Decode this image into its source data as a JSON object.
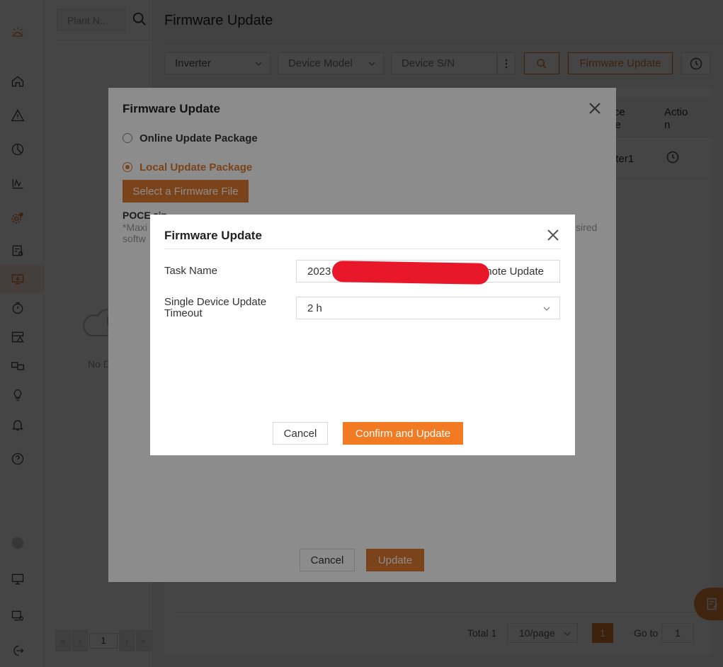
{
  "plant_panel": {
    "search_placeholder": "Plant N...",
    "empty_text": "No D",
    "pager_value": "1"
  },
  "main": {
    "title": "Firmware Update",
    "filters": {
      "device_type": "Inverter",
      "device_model_placeholder": "Device Model",
      "device_sn_placeholder": "Device S/N"
    },
    "firmware_update_button": "Firmware Update",
    "table": {
      "headers": [
        "vice\nme",
        "Actio\nn"
      ],
      "row_device_name": "erter1"
    },
    "footer": {
      "total": "Total 1",
      "page_size": "10/page",
      "current_page": "1",
      "goto_label": "Go to",
      "goto_value": "1"
    }
  },
  "back_modal": {
    "title": "Firmware Update",
    "option_online": "Online Update Package",
    "option_local": "Local Update Package",
    "select_file_button": "Select a Firmware File",
    "file_name": "POCE.zip",
    "note_line1": "*Maxi",
    "note_line1_end": "sired",
    "note_line2": "softw",
    "cancel": "Cancel",
    "update": "Update"
  },
  "front_modal": {
    "title": "Firmware Update",
    "task_name_label": "Task Name",
    "task_name_value_start": "2023",
    "task_name_value_end": "note Update",
    "timeout_label": "Single Device Update Timeout",
    "timeout_value": "2 h",
    "cancel": "Cancel",
    "confirm": "Confirm and Update"
  },
  "colors": {
    "accent": "#e07a2e",
    "confirm": "#f27a23",
    "redaction": "#e8172a"
  }
}
